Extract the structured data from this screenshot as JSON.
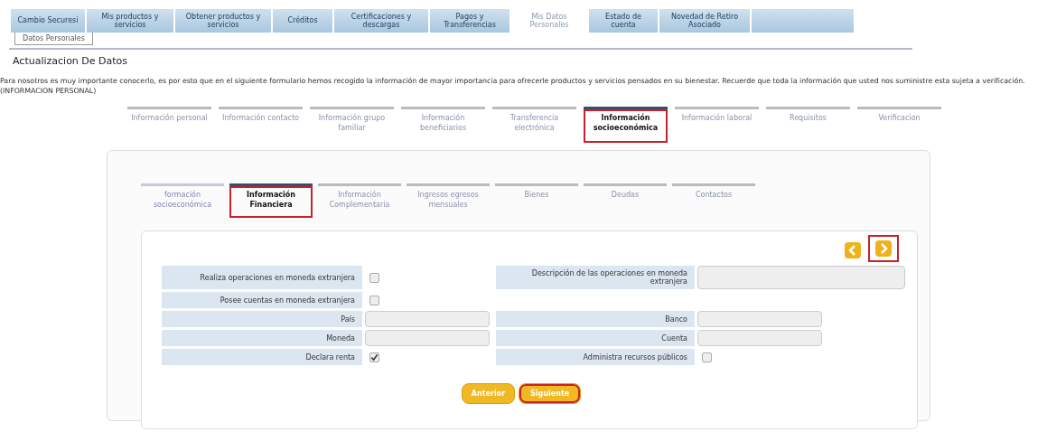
{
  "tabs": [
    {
      "label": "Cambio Securesi",
      "selected": false
    },
    {
      "label": "Mis productos y servicios",
      "selected": false
    },
    {
      "label": "Obtener productos y servicios",
      "selected": false
    },
    {
      "label": "Créditos",
      "selected": false
    },
    {
      "label": "Certificaciones y descargas",
      "selected": false
    },
    {
      "label": "Pagos y Transferencias",
      "selected": false
    },
    {
      "label": "Mis Datos Personales",
      "selected": true
    },
    {
      "label": "Estado de cuenta",
      "selected": false
    },
    {
      "label": "Novedad de Retiro Asociado",
      "selected": false
    }
  ],
  "subtabs": [
    {
      "label": "Datos Personales",
      "selected": true
    }
  ],
  "page_title": "Actualizacion De Datos",
  "intro": "Para nosotros es muy importante conocerlo, es por esto que en el siguiente formulario hemos recogido la información de mayor importancia para ofrecerle productos y servicios pensados en su bienestar. Recuerde que toda la información que usted nos suministre esta sujeta a verificación.(INFORMACION PERSONAL)",
  "steps": [
    {
      "label": "Información personal",
      "selected": false,
      "highlighted": false
    },
    {
      "label": "Información contacto",
      "selected": false,
      "highlighted": false
    },
    {
      "label": "Información grupo familiar",
      "selected": false,
      "highlighted": false
    },
    {
      "label": "Información beneficiarios",
      "selected": false,
      "highlighted": false
    },
    {
      "label": "Transferencia electrónica",
      "selected": false,
      "highlighted": false
    },
    {
      "label": "Información socioeconómica",
      "selected": true,
      "highlighted": true
    },
    {
      "label": "Información laboral",
      "selected": false,
      "highlighted": false
    },
    {
      "label": "Requisitos",
      "selected": false,
      "highlighted": false
    },
    {
      "label": "Verificacion",
      "selected": false,
      "highlighted": false
    }
  ],
  "substeps": [
    {
      "label": "formación socioeconómica",
      "selected": false,
      "highlighted": false
    },
    {
      "label": "Información Financiera",
      "selected": true,
      "highlighted": true
    },
    {
      "label": "Información Complementaria",
      "selected": false,
      "highlighted": false
    },
    {
      "label": "Ingresos egresos mensuales",
      "selected": false,
      "highlighted": false
    },
    {
      "label": "Bienes",
      "selected": false,
      "highlighted": false
    },
    {
      "label": "Deudas",
      "selected": false,
      "highlighted": false
    },
    {
      "label": "Contactos",
      "selected": false,
      "highlighted": false
    }
  ],
  "nav_arrows": [
    {
      "kind": "previous",
      "highlighted": false
    },
    {
      "kind": "next",
      "highlighted": true
    }
  ],
  "form_rows": [
    {
      "left": {
        "label": "Realiza operaciones en moneda extranjera",
        "kind": "checkbox",
        "checked": false
      },
      "right": {
        "label": "Descripción de las operaciones en moneda extranjera",
        "kind": "textarea"
      }
    },
    {
      "left": {
        "label": "Posee cuentas en moneda extranjera",
        "kind": "checkbox",
        "checked": false
      }
    },
    {
      "left": {
        "label": "País",
        "kind": "text"
      },
      "right": {
        "label": "Banco",
        "kind": "text"
      }
    },
    {
      "left": {
        "label": "Moneda",
        "kind": "text"
      },
      "right": {
        "label": "Cuenta",
        "kind": "text"
      }
    },
    {
      "left": {
        "label": "Declara renta",
        "kind": "checkbox",
        "checked": true
      },
      "right": {
        "label": "Administra recursos públicos",
        "kind": "checkbox",
        "checked": false
      }
    }
  ],
  "buttons": [
    {
      "label": "Anterior",
      "highlighted": false
    },
    {
      "label": "Siguiente",
      "highlighted": true
    }
  ]
}
